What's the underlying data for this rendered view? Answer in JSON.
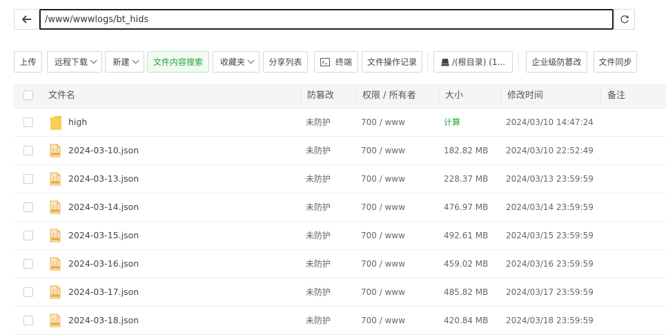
{
  "path_bar": {
    "path": "/www/wwwlogs/bt_hids",
    "back_icon": "arrow-left-icon",
    "refresh_icon": "refresh-icon"
  },
  "toolbar": {
    "upload": "上传",
    "remote_download": "远程下载",
    "new": "新建",
    "content_search": "文件内容搜索",
    "favorites": "收藏夹",
    "share_list": "分享列表",
    "terminal": "终端",
    "op_log": "文件操作记录",
    "disk": "/(根目录) (1...",
    "tamper_proof": "企业级防篡改",
    "file_sync": "文件同步"
  },
  "table": {
    "headers": {
      "name": "文件名",
      "protect": "防篡改",
      "perm": "权限 / 所有者",
      "size": "大小",
      "mtime": "修改时间",
      "remark": "备注"
    },
    "rows": [
      {
        "name": "high",
        "type": "folder",
        "protect": "未防护",
        "perm": "700 / www",
        "size": "计算",
        "mtime": "2024/03/10 14:47:24"
      },
      {
        "name": "2024-03-10.json",
        "type": "json",
        "protect": "未防护",
        "perm": "700 / www",
        "size": "182.82 MB",
        "mtime": "2024/03/10 22:52:49"
      },
      {
        "name": "2024-03-13.json",
        "type": "json",
        "protect": "未防护",
        "perm": "700 / www",
        "size": "228.37 MB",
        "mtime": "2024/03/13 23:59:59"
      },
      {
        "name": "2024-03-14.json",
        "type": "json",
        "protect": "未防护",
        "perm": "700 / www",
        "size": "476.97 MB",
        "mtime": "2024/03/14 23:59:59"
      },
      {
        "name": "2024-03-15.json",
        "type": "json",
        "protect": "未防护",
        "perm": "700 / www",
        "size": "492.61 MB",
        "mtime": "2024/03/15 23:59:59"
      },
      {
        "name": "2024-03-16.json",
        "type": "json",
        "protect": "未防护",
        "perm": "700 / www",
        "size": "459.02 MB",
        "mtime": "2024/03/16 23:59:59"
      },
      {
        "name": "2024-03-17.json",
        "type": "json",
        "protect": "未防护",
        "perm": "700 / www",
        "size": "485.82 MB",
        "mtime": "2024/03/17 23:59:59"
      },
      {
        "name": "2024-03-18.json",
        "type": "json",
        "protect": "未防护",
        "perm": "700 / www",
        "size": "420.84 MB",
        "mtime": "2024/03/18 23:59:59"
      }
    ]
  },
  "colors": {
    "accent_green": "#20a53a",
    "folder_yellow": "#f6c443",
    "json_icon": "#e9b04a"
  }
}
